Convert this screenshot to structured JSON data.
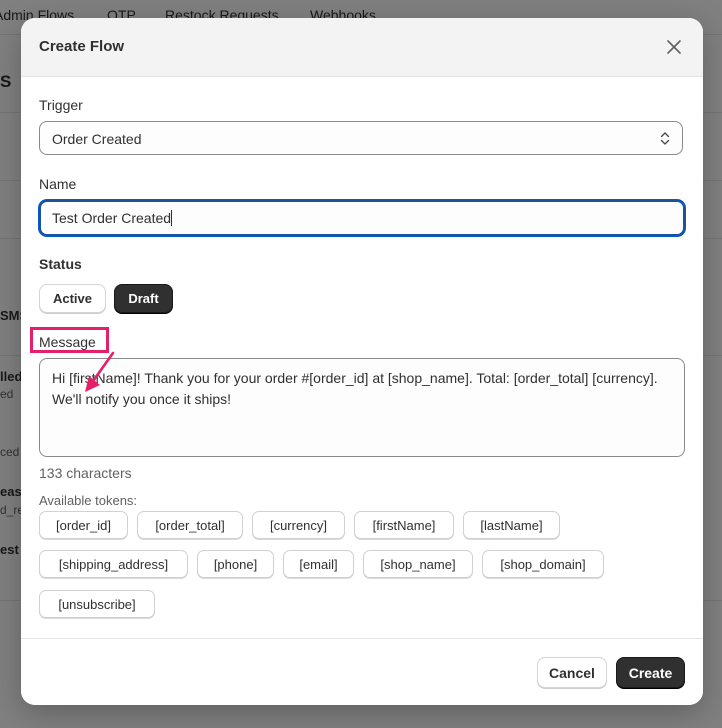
{
  "background": {
    "tabs": [
      "Admin Flows",
      "OTP",
      "Restock Requests",
      "Webhooks"
    ],
    "fragments": [
      "S",
      "SMS",
      "lled",
      "ed",
      "ced",
      "eas",
      "d_re",
      "est"
    ]
  },
  "modal": {
    "title": "Create Flow",
    "close_icon": "close-icon"
  },
  "trigger": {
    "label": "Trigger",
    "value": "Order Created",
    "icon": "chevron-up-down-icon"
  },
  "name": {
    "label": "Name",
    "value": "Test Order Created"
  },
  "status": {
    "label": "Status",
    "options": [
      {
        "label": "Active",
        "selected": false
      },
      {
        "label": "Draft",
        "selected": true
      }
    ]
  },
  "message": {
    "label": "Message",
    "value": "Hi [firstName]! Thank you for your order #[order_id] at [shop_name]. Total: [order_total] [currency]. We'll notify you once it ships!",
    "char_count": "133 characters"
  },
  "tokens": {
    "label": "Available tokens:",
    "items": [
      "[order_id]",
      "[order_total]",
      "[currency]",
      "[firstName]",
      "[lastName]",
      "[shipping_address]",
      "[phone]",
      "[email]",
      "[shop_name]",
      "[shop_domain]",
      "[unsubscribe]"
    ]
  },
  "footer": {
    "cancel_label": "Cancel",
    "create_label": "Create"
  },
  "colors": {
    "annotation": "#e5206b",
    "focus": "#005bd3",
    "primary_button": "#303030"
  }
}
